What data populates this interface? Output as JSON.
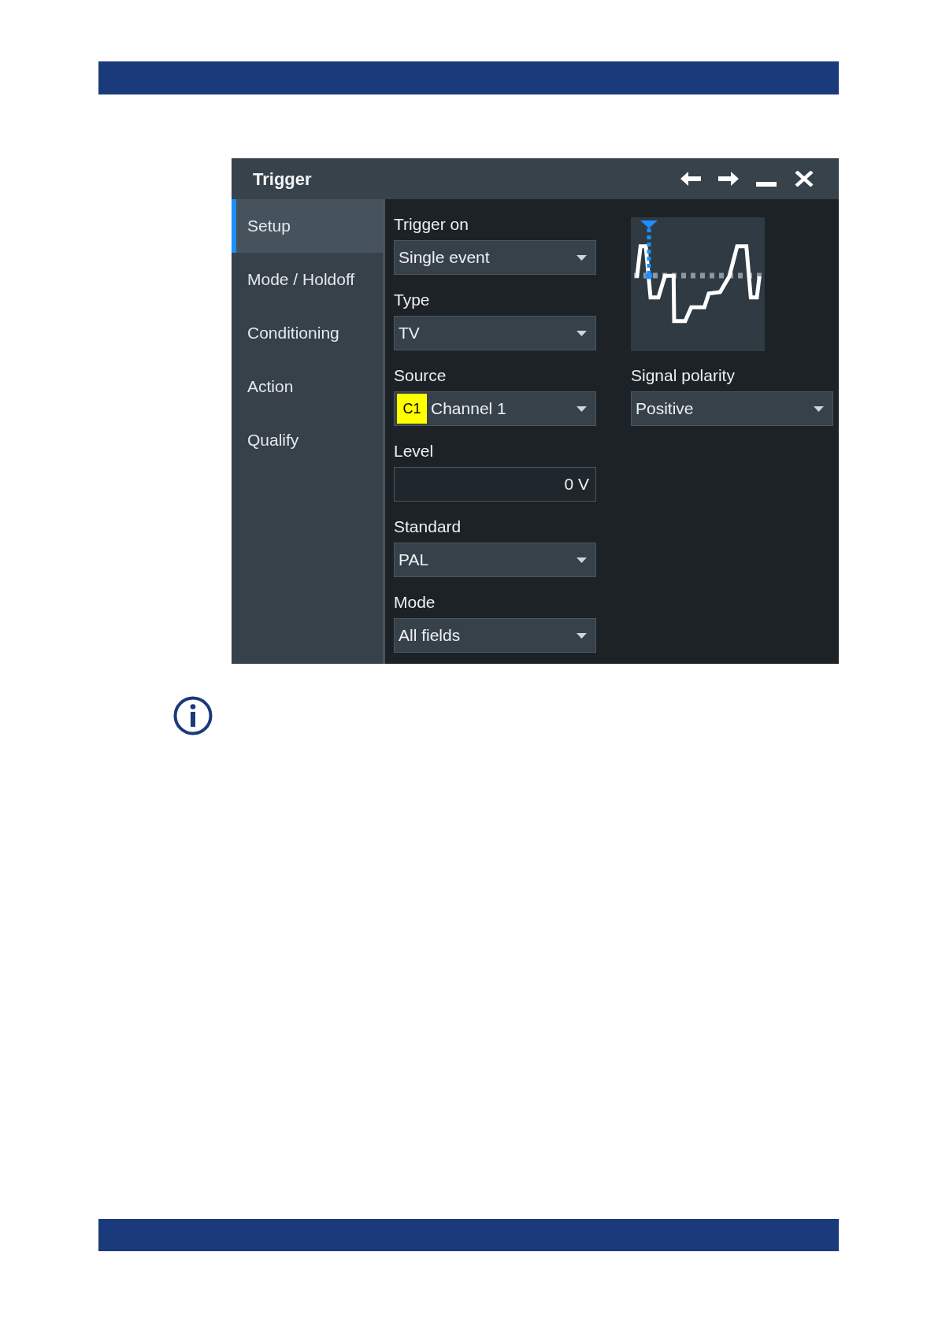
{
  "window": {
    "title": "Trigger"
  },
  "sidebar": {
    "items": [
      {
        "label": "Setup",
        "selected": true
      },
      {
        "label": "Mode / Holdoff",
        "selected": false
      },
      {
        "label": "Conditioning",
        "selected": false
      },
      {
        "label": "Action",
        "selected": false
      },
      {
        "label": "Qualify",
        "selected": false
      }
    ]
  },
  "left_fields": [
    {
      "kind": "dropdown",
      "label": "Trigger on",
      "value": "Single event"
    },
    {
      "kind": "dropdown",
      "label": "Type",
      "value": "TV"
    },
    {
      "kind": "dropdown",
      "label": "Source",
      "tag": {
        "text": "C1",
        "color": "#ffff00"
      },
      "value": "Channel 1"
    },
    {
      "kind": "input",
      "label": "Level",
      "value": "0 V"
    },
    {
      "kind": "dropdown",
      "label": "Standard",
      "value": "PAL"
    },
    {
      "kind": "dropdown",
      "label": "Mode",
      "value": "All fields"
    }
  ],
  "right_fields": [
    {
      "kind": "dropdown",
      "label": "Signal polarity",
      "value": "Positive"
    }
  ]
}
